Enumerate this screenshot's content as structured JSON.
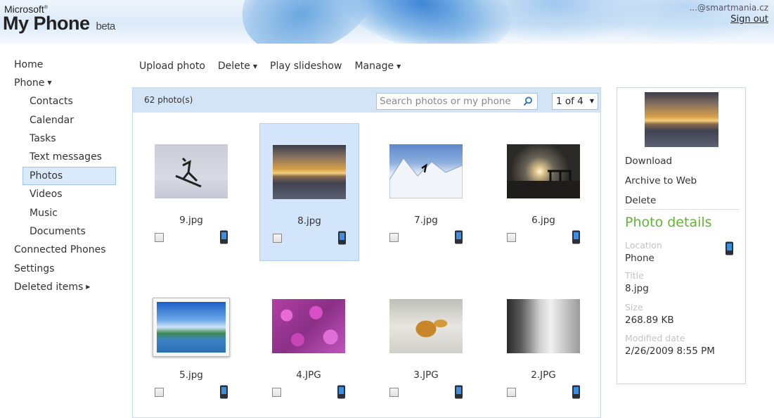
{
  "header": {
    "brand_small": "Microsoft",
    "brand_reg": "®",
    "brand_name": "My Phone",
    "brand_beta": "beta",
    "user_email": "...@smartmania.cz",
    "sign_out": "Sign out"
  },
  "nav": {
    "home": "Home",
    "phone": "Phone",
    "contacts": "Contacts",
    "calendar": "Calendar",
    "tasks": "Tasks",
    "text_messages": "Text messages",
    "photos": "Photos",
    "videos": "Videos",
    "music": "Music",
    "documents": "Documents",
    "connected_phones": "Connected Phones",
    "settings": "Settings",
    "deleted_items": "Deleted items"
  },
  "toolbar": {
    "upload": "Upload photo",
    "delete": "Delete",
    "slideshow": "Play slideshow",
    "manage": "Manage"
  },
  "gallery": {
    "count": "62 photo(s)",
    "search_placeholder": "Search photos or my phone",
    "page": "1 of 4",
    "photos": [
      {
        "name": "9.jpg",
        "thumb": "skier-sky"
      },
      {
        "name": "8.jpg",
        "thumb": "sunset-sea",
        "selected": true
      },
      {
        "name": "7.jpg",
        "thumb": "mountain-skier"
      },
      {
        "name": "6.jpg",
        "thumb": "dusk-pier"
      },
      {
        "name": "5.jpg",
        "thumb": "lake-landscape"
      },
      {
        "name": "4.JPG",
        "thumb": "pink-flowers"
      },
      {
        "name": "3.JPG",
        "thumb": "frozen-leaves"
      },
      {
        "name": "2.JPG",
        "thumb": "ice-bw"
      }
    ]
  },
  "panel": {
    "download": "Download",
    "archive": "Archive to Web",
    "delete": "Delete",
    "details_title": "Photo details",
    "location_label": "Location",
    "location_value": "Phone",
    "title_label": "Title",
    "title_value": "8.jpg",
    "size_label": "Size",
    "size_value": "268.89 KB",
    "modified_label": "Modified date",
    "modified_value": "2/26/2009 8:55 PM"
  },
  "colors": {
    "accent_green": "#62b33a",
    "selection_blue": "#d3e5fb",
    "bar_blue": "#d3e4f6"
  }
}
